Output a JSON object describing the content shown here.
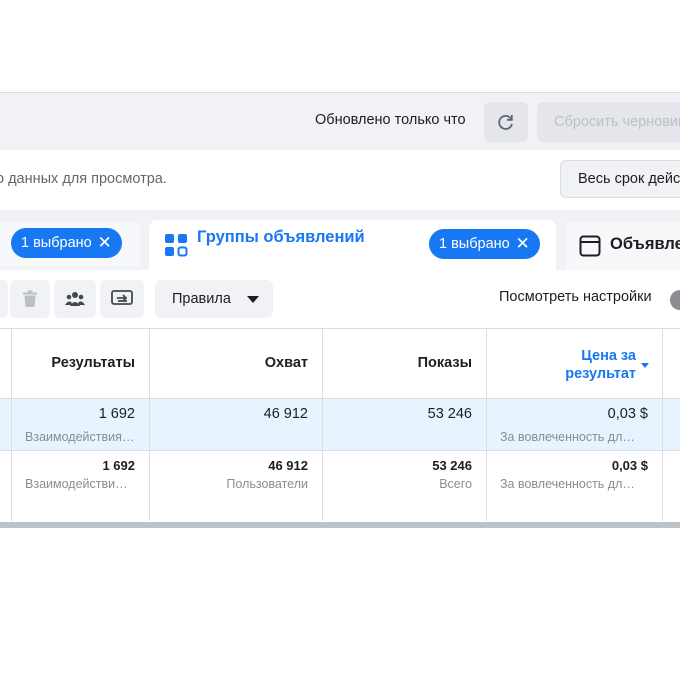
{
  "topbar": {
    "updated_text": "Обновлено только что",
    "refresh_icon": "refresh-icon",
    "reset_label": "Сбросить черновик"
  },
  "info": {
    "text": "о данных для просмотра.",
    "period_label": "Весь срок действия"
  },
  "tabs": {
    "left": {
      "pill_label": "1 выбрано"
    },
    "active": {
      "icon": "grid-icon",
      "title": "Группы объявлений",
      "pill_label": "1 выбрано"
    },
    "right": {
      "icon": "window-icon",
      "title": "Объявления"
    }
  },
  "actions": {
    "icons": [
      "trash-icon",
      "people-icon",
      "export-icon"
    ],
    "rules_label": "Правила",
    "view_settings_label": "Посмотреть настройки",
    "accent": "#1877f2"
  },
  "table": {
    "headers": {
      "results": "Результаты",
      "reach": "Охват",
      "impressions": "Показы",
      "cost_line1": "Цена за",
      "cost_line2": "результат"
    },
    "rows": [
      {
        "results": "1 692",
        "results_sub": "Взаимодействия…",
        "reach": "46 912",
        "reach_sub": "",
        "impressions": "53 246",
        "impressions_sub": "",
        "cost": "0,03 $",
        "cost_sub": "За вовлеченность дл…"
      },
      {
        "results": "1 692",
        "results_sub": "Взаимодействи…",
        "reach": "46 912",
        "reach_sub": "Пользователи",
        "impressions": "53 246",
        "impressions_sub": "Всего",
        "cost": "0,03 $",
        "cost_sub": "За вовлеченность дл…"
      }
    ]
  }
}
